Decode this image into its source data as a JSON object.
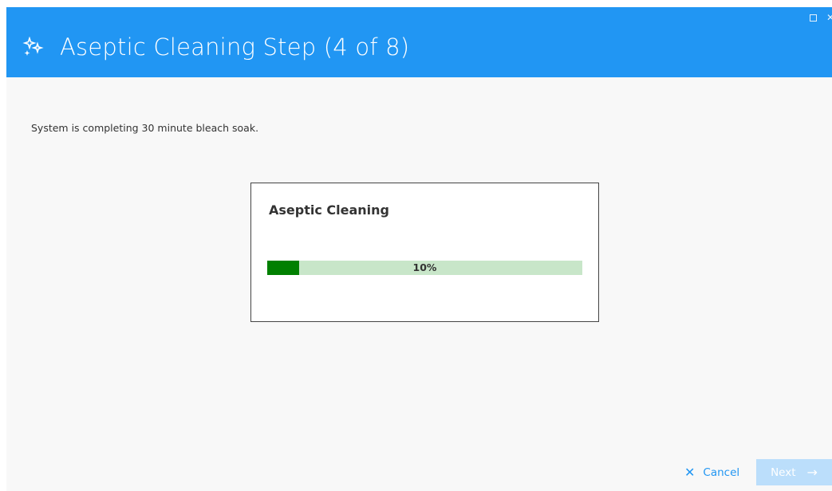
{
  "window": {
    "title": "Aseptic Cleaning Step (4 of 8)",
    "title_icon": "sparkle-icon",
    "maximize_icon": "maximize-icon",
    "close_icon": "close-icon",
    "accent_color": "#2196f3"
  },
  "main": {
    "message": "System is completing 30 minute bleach soak."
  },
  "progress_card": {
    "title": "Aseptic Cleaning",
    "progress_percent": 10,
    "progress_label": "10%",
    "fill_color": "#008000",
    "track_color": "#c8e6c9"
  },
  "footer": {
    "cancel_label": "Cancel",
    "cancel_icon": "close-x-icon",
    "next_label": "Next",
    "next_icon": "arrow-right-icon",
    "next_enabled": false
  }
}
